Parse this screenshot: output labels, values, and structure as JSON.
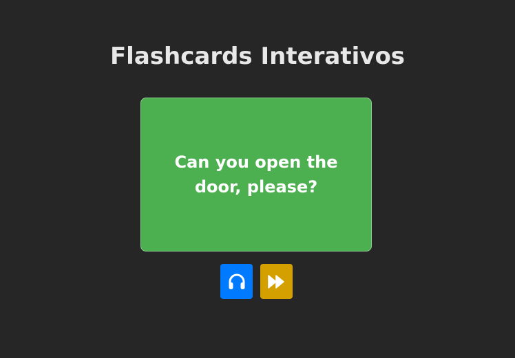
{
  "app": {
    "title": "Flashcards Interativos"
  },
  "card": {
    "text": "Can you open the door, please?",
    "color": "#4caf50"
  },
  "controls": {
    "listen": {
      "icon": "headphones-icon",
      "color": "#007bff"
    },
    "next": {
      "icon": "fast-forward-icon",
      "color": "#d4a000"
    }
  }
}
